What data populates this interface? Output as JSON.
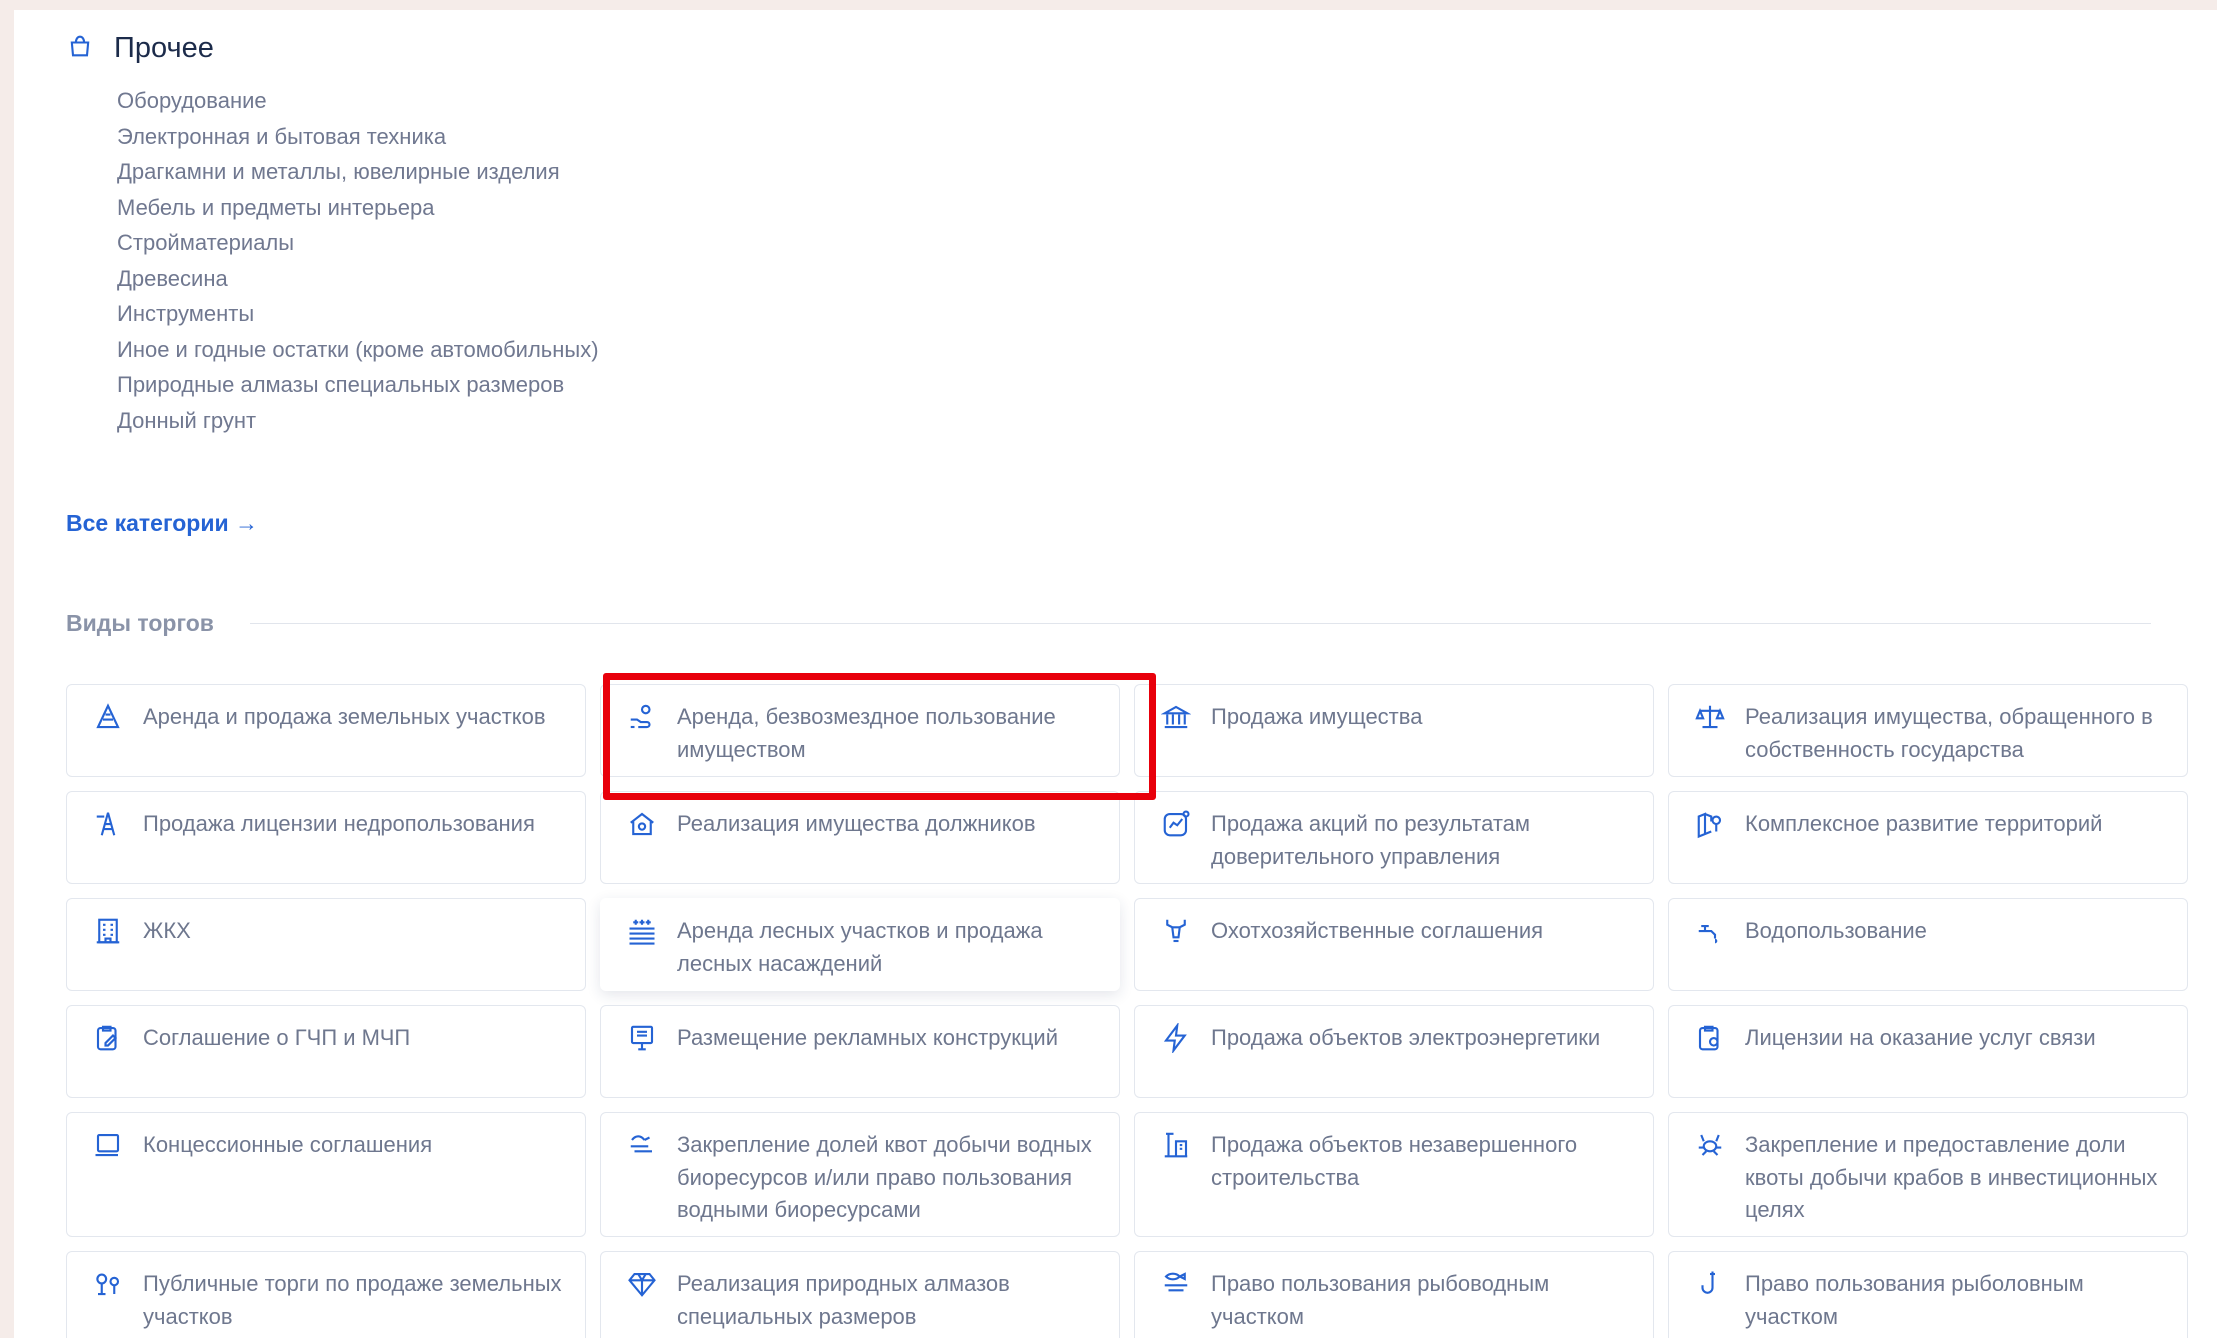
{
  "other": {
    "title": "Прочее",
    "icon": "bag-icon",
    "items": [
      "Оборудование",
      "Электронная и бытовая техника",
      "Драгкамни и металлы, ювелирные изделия",
      "Мебель и предметы интерьера",
      "Стройматериалы",
      "Древесина",
      "Инструменты",
      "Иное и годные остатки (кроме автомобильных)",
      "Природные алмазы специальных размеров",
      "Донный грунт"
    ]
  },
  "all_categories_link": "Все категории →",
  "trade_types": {
    "title": "Виды торгов",
    "cards": [
      {
        "label": "Аренда и продажа земельных участков",
        "icon": "land-plot-icon"
      },
      {
        "label": "Аренда, безвозмездное пользование имуществом",
        "icon": "hand-coins-icon"
      },
      {
        "label": "Продажа имущества",
        "icon": "bank-building-icon"
      },
      {
        "label": "Реализация имущества, обращенного в собственность государства",
        "icon": "scales-icon"
      },
      {
        "label": "Продажа лицензии недропользования",
        "icon": "oil-rig-icon"
      },
      {
        "label": "Реализация имущества должников",
        "icon": "house-icon"
      },
      {
        "label": "Продажа акций по результатам доверительного управления",
        "icon": "stock-chart-icon"
      },
      {
        "label": "Комплексное развитие территорий",
        "icon": "map-pin-icon"
      },
      {
        "label": "ЖКХ",
        "icon": "apartment-building-icon"
      },
      {
        "label": "Аренда лесных участков и продажа лесных насаждений",
        "icon": "forest-icon"
      },
      {
        "label": "Охотхозяйственные соглашения",
        "icon": "deer-icon"
      },
      {
        "label": "Водопользование",
        "icon": "water-tap-icon"
      },
      {
        "label": "Соглашение о ГЧП и МЧП",
        "icon": "contract-edit-icon"
      },
      {
        "label": "Размещение рекламных конструкций",
        "icon": "billboard-icon"
      },
      {
        "label": "Продажа объектов электроэнергетики",
        "icon": "lightning-icon"
      },
      {
        "label": "Лицензии на оказание услуг связи",
        "icon": "communication-license-icon"
      },
      {
        "label": "Концессионные соглашения",
        "icon": "laptop-icon"
      },
      {
        "label": "Закрепление долей квот добычи водных биоресурсов и/или право пользования водными биоресурсами",
        "icon": "fish-icon"
      },
      {
        "label": "Продажа объектов незавершенного строительства",
        "icon": "construction-icon"
      },
      {
        "label": "Закрепление и предоставление доли квоты добычи крабов в инвестиционных целях",
        "icon": "crab-icon"
      },
      {
        "label": "Публичные торги по продаже земельных участков",
        "icon": "location-pins-icon"
      },
      {
        "label": "Реализация природных алмазов специальных размеров",
        "icon": "diamond-icon"
      },
      {
        "label": "Право пользования рыбоводным участком",
        "icon": "fish-farm-icon"
      },
      {
        "label": "Право пользования рыболовным участком",
        "icon": "fishing-hook-icon"
      }
    ]
  },
  "colors": {
    "accent": "#2563d4",
    "highlight": "#e8000b",
    "text_muted": "#6e778e",
    "title": "#1c2b4a",
    "page_bg": "#f5ece9"
  }
}
